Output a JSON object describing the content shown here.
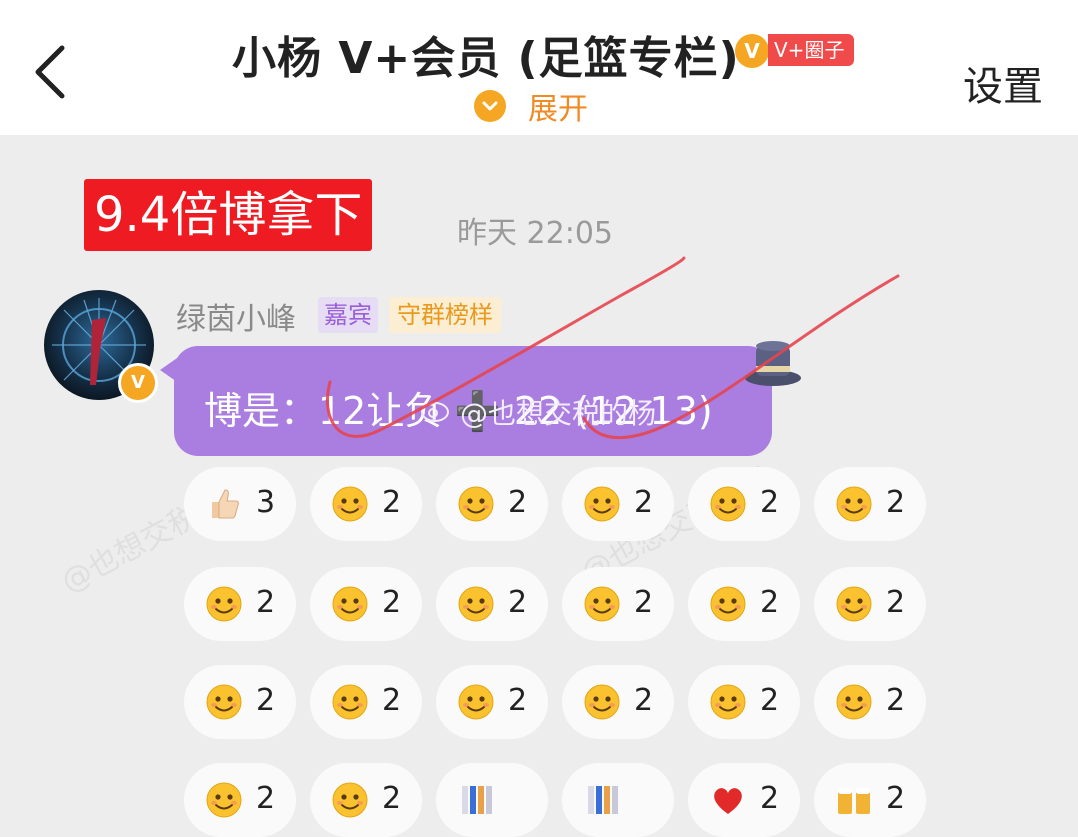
{
  "header": {
    "title": "小杨 V+会员 (足篮专栏)",
    "vip_badge": "V",
    "vip_tag": "V+圈子",
    "expand_label": "展开",
    "settings_label": "设置"
  },
  "message": {
    "headline": "9.4倍博拿下",
    "time": "昨天 22:05",
    "sender": "绿茵小峰",
    "tags": [
      "嘉宾",
      "守群榜样"
    ],
    "content": "博是：12让负 ➕ 22 (12 13)",
    "watermark": "@也想交税的杨",
    "avatar_verified": "V"
  },
  "reactions": [
    {
      "icon": "thumbs-up-icon",
      "count": "3"
    },
    {
      "icon": "shy-face-icon",
      "count": "2"
    },
    {
      "icon": "pray-face-icon",
      "count": "2"
    },
    {
      "icon": "grin-face-icon",
      "count": "2"
    },
    {
      "icon": "laugh-face-icon",
      "count": "2"
    },
    {
      "icon": "kiss-face-icon",
      "count": "2"
    },
    {
      "icon": "amazed-face-icon",
      "count": "2"
    },
    {
      "icon": "excited-face-icon",
      "count": "2"
    },
    {
      "icon": "666-face-icon",
      "count": "2"
    },
    {
      "icon": "think-face-icon",
      "count": "2"
    },
    {
      "icon": "cheer-face-icon",
      "count": "2"
    },
    {
      "icon": "rainbow-face-icon",
      "count": "2"
    },
    {
      "icon": "flower-face-icon",
      "count": "2"
    },
    {
      "icon": "heart-eyes-face-icon",
      "count": "2"
    },
    {
      "icon": "surprised-face-icon",
      "count": "2"
    },
    {
      "icon": "salute-face-icon",
      "count": "2"
    },
    {
      "icon": "smug-face-icon",
      "count": "2"
    },
    {
      "icon": "wink-face-icon",
      "count": "2"
    },
    {
      "icon": "cry-laugh-face-icon",
      "count": "2"
    },
    {
      "icon": "headband-face-icon",
      "count": "2"
    },
    {
      "icon": "blurred-icon",
      "count": ""
    },
    {
      "icon": "blurred-icon",
      "count": ""
    },
    {
      "icon": "heart-icon",
      "count": "2"
    },
    {
      "icon": "beer-icon",
      "count": "2"
    }
  ],
  "colors": {
    "accent": "#f5a623",
    "headline_bg": "#ef1b22",
    "bubble_bg": "#a97ee0",
    "guest_tag": "#9a5fd9",
    "rank_tag": "#e89a1e"
  }
}
